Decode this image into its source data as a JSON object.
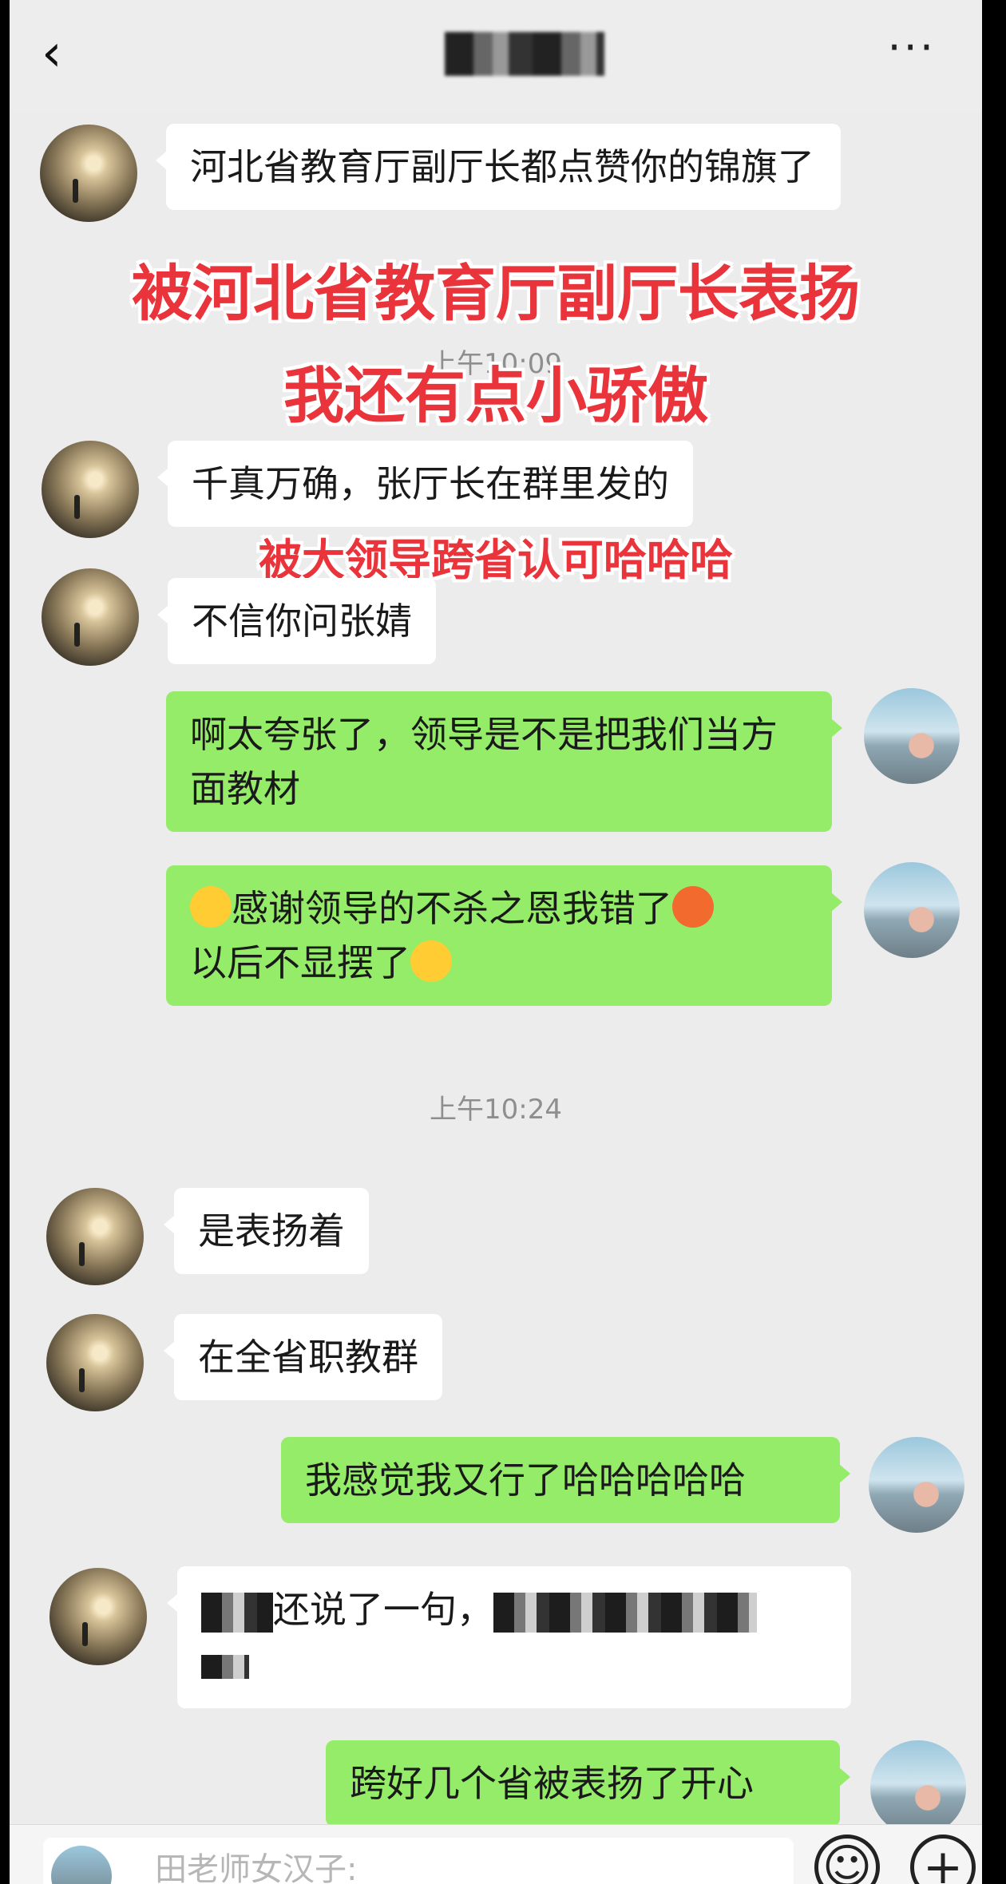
{
  "header": {
    "back_icon": "‹",
    "more_icon": "···"
  },
  "overlays": {
    "headline_1": "被河北省教育厅副厅长表扬",
    "headline_2": "我还有点小骄傲",
    "sub_caption": "被大领导跨省认可哈哈哈"
  },
  "timestamps": {
    "t1": "上午10:09",
    "t2": "上午10:24"
  },
  "messages": {
    "m1": "河北省教育厅副厅长都点赞你的锦旗了",
    "m2": "千真万确，张厅长在群里发的",
    "m3": "不信你问张婧",
    "m4": "啊太夸张了，领导是不是把我们当方面教材",
    "m5_a": "感谢领导的不杀之恩我错了",
    "m5_b": "以后不显摆了",
    "m6": "是表扬着",
    "m7": "在全省职教群",
    "m8": "我感觉我又行了哈哈哈哈哈",
    "m9": "还说了一句，",
    "m10": "跨好几个省被表扬了开心"
  },
  "input": {
    "placeholder": "田老师女汉子:"
  },
  "icons": {
    "emoji_button": "emoji-face-icon",
    "plus_button": "plus-icon"
  }
}
